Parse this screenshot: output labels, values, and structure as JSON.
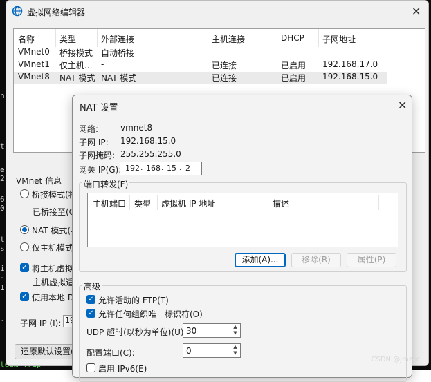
{
  "editor": {
    "title": "虚拟网络编辑器",
    "columns": [
      "名称",
      "类型",
      "外部连接",
      "主机连接",
      "DHCP",
      "子网地址"
    ],
    "rows": [
      [
        "VMnet0",
        "桥接模式",
        "自动桥接",
        "-",
        "-",
        "-"
      ],
      [
        "VMnet1",
        "仅主机...",
        "-",
        "已连接",
        "已启用",
        "192.168.17.0"
      ],
      [
        "VMnet8",
        "NAT 模式",
        "NAT 模式",
        "已连接",
        "已启用",
        "192.168.15.0"
      ]
    ],
    "vmnet_info_label": "VMnet 信息",
    "bridge_mode_partial": "桥接模式(将",
    "bridged_to_partial": "已桥接至(G",
    "nat_mode_partial": "NAT 模式(与",
    "host_only_partial": "仅主机模式",
    "connect_host_adapter_partial": "将主机虚拟",
    "host_adapter_name_partial": "主机虚拟适",
    "use_local_dhcp_partial": "使用本地 D",
    "subnet_ip_label": "子网 IP (I):",
    "subnet_ip_partial": "19",
    "restore_defaults_partial": "还原默认设置(R"
  },
  "nat": {
    "title": "NAT 设置",
    "network_label": "网络:",
    "network_value": "vmnet8",
    "subnet_ip_label": "子网 IP:",
    "subnet_ip_value": "192.168.15.0",
    "subnet_mask_label": "子网掩码:",
    "subnet_mask_value": "255.255.255.0",
    "gateway_label": "网关 IP(G):",
    "gateway_octets": [
      "192",
      "168",
      "15",
      "2"
    ],
    "port_forwarding_label": "端口转发(F)",
    "pf_columns": [
      "主机端口",
      "类型",
      "虚拟机 IP 地址",
      "描述"
    ],
    "add_button": "添加(A)...",
    "remove_button": "移除(R)",
    "properties_button": "属性(P)",
    "advanced_label": "高级",
    "allow_active_ftp": "允许活动的 FTP(T)",
    "allow_any_oui": "允许任何组织唯一标识符(O)",
    "udp_timeout_label": "UDP 超时(以秒为单位)(U):",
    "udp_timeout_value": "30",
    "config_port_label": "配置端口(C):",
    "config_port_value": "0",
    "enable_ipv6_label": "启用 IPv6(E)"
  },
  "watermark": "CSDN @jmzcc",
  "terminal": {
    "left_chars": [
      "h",
      "t",
      "e",
      "2",
      "6",
      "0",
      "t",
      "s",
      "i",
      "-",
      "1",
      "."
    ],
    "bottom_text": "team     Trup"
  },
  "colors": {
    "accent": "#0067c0",
    "dialog_bg": "#f3f3f3",
    "terminal_bg": "#0c0c0c"
  }
}
